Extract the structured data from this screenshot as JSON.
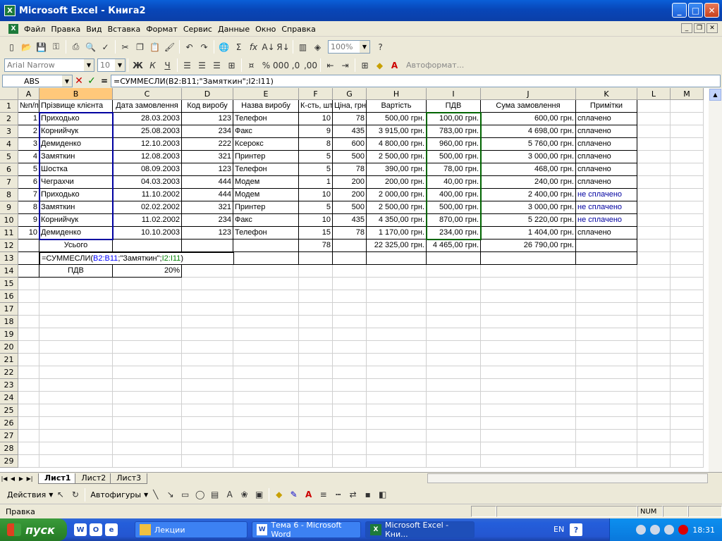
{
  "window": {
    "title": "Microsoft Excel - Книга2"
  },
  "menu": [
    "Файл",
    "Правка",
    "Вид",
    "Вставка",
    "Формат",
    "Сервис",
    "Данные",
    "Окно",
    "Справка"
  ],
  "toolbar": {
    "zoom": "100%",
    "font": "Arial Narrow",
    "size": "10",
    "autoformat": "Автоформат..."
  },
  "formula_bar": {
    "name_box": "ABS",
    "formula": "=СУММЕСЛИ(B2:B11;\"Заmяткин\";I2:I11)"
  },
  "columns": [
    "A",
    "B",
    "C",
    "D",
    "E",
    "F",
    "G",
    "H",
    "I",
    "J",
    "K",
    "L",
    "M"
  ],
  "rows": [
    "1",
    "2",
    "3",
    "4",
    "5",
    "6",
    "7",
    "8",
    "9",
    "10",
    "11",
    "12",
    "13",
    "14",
    "15",
    "16",
    "17",
    "18",
    "19",
    "20",
    "21",
    "22",
    "23",
    "24",
    "25",
    "26",
    "27",
    "28",
    "29"
  ],
  "table": {
    "headers": [
      "№п/п",
      "Прізвище клієнта",
      "Дата замовлення",
      "Код виробу",
      "Назва виробу",
      "К-сть, шт",
      "Ціна, грн",
      "Вартість",
      "ПДВ",
      "Сума замовлення",
      "Примітки"
    ],
    "rows": [
      [
        "1",
        "Приходько",
        "28.03.2003",
        "123",
        "Телефон",
        "10",
        "78",
        "500,00 грн.",
        "100,00 грн.",
        "600,00 грн.",
        "сплачено"
      ],
      [
        "2",
        "Корнийчук",
        "25.08.2003",
        "234",
        "Факс",
        "9",
        "435",
        "3 915,00 грн.",
        "783,00 грн.",
        "4 698,00 грн.",
        "сплачено"
      ],
      [
        "3",
        "Демиденко",
        "12.10.2003",
        "222",
        "Ксерокс",
        "8",
        "600",
        "4 800,00 грн.",
        "960,00 грн.",
        "5 760,00 грн.",
        "сплачено"
      ],
      [
        "4",
        "Замяткин",
        "12.08.2003",
        "321",
        "Принтер",
        "5",
        "500",
        "2 500,00 грн.",
        "500,00 грн.",
        "3 000,00 грн.",
        "сплачено"
      ],
      [
        "5",
        "Шостка",
        "08.09.2003",
        "123",
        "Телефон",
        "5",
        "78",
        "390,00 грн.",
        "78,00 грн.",
        "468,00 грн.",
        "сплачено"
      ],
      [
        "6",
        "Чеграхчи",
        "04.03.2003",
        "444",
        "Модем",
        "1",
        "200",
        "200,00 грн.",
        "40,00 грн.",
        "240,00 грн.",
        "сплачено"
      ],
      [
        "7",
        "Приходько",
        "11.10.2002",
        "444",
        "Модем",
        "10",
        "200",
        "2 000,00 грн.",
        "400,00 грн.",
        "2 400,00 грн.",
        "не сплачено"
      ],
      [
        "8",
        "Замяткин",
        "02.02.2002",
        "321",
        "Принтер",
        "5",
        "500",
        "2 500,00 грн.",
        "500,00 грн.",
        "3 000,00 грн.",
        "не сплачено"
      ],
      [
        "9",
        "Корнийчук",
        "11.02.2002",
        "234",
        "Факс",
        "10",
        "435",
        "4 350,00 грн.",
        "870,00 грн.",
        "5 220,00 грн.",
        "не сплачено"
      ],
      [
        "10",
        "Демиденко",
        "10.10.2003",
        "123",
        "Телефон",
        "15",
        "78",
        "1 170,00 грн.",
        "234,00 грн.",
        "1 404,00 грн.",
        "сплачено"
      ]
    ],
    "total_label": "Усього",
    "total_qty": "78",
    "total_cost": "22 325,00 грн.",
    "total_vat": "4 465,00 грн.",
    "total_sum": "26 790,00 грн.",
    "edit_formula": {
      "p1": "=СУММЕСЛИ(",
      "p2": "B2:B11",
      "p3": ";\"Замяткин\";",
      "p4": "I2:I11",
      "p5": ")"
    },
    "vat_label": "ПДВ",
    "vat_rate": "20%"
  },
  "sheets": [
    "Лист1",
    "Лист2",
    "Лист3"
  ],
  "drawing": {
    "actions": "Действия",
    "autoshapes": "Автофигуры"
  },
  "status": {
    "mode": "Правка",
    "num": "NUM"
  },
  "taskbar": {
    "start": "пуск",
    "tasks": [
      "Лекции",
      "Тема 6 - Microsoft Word",
      "Microsoft Excel - Кни..."
    ],
    "lang": "EN",
    "clock": "18:31"
  }
}
